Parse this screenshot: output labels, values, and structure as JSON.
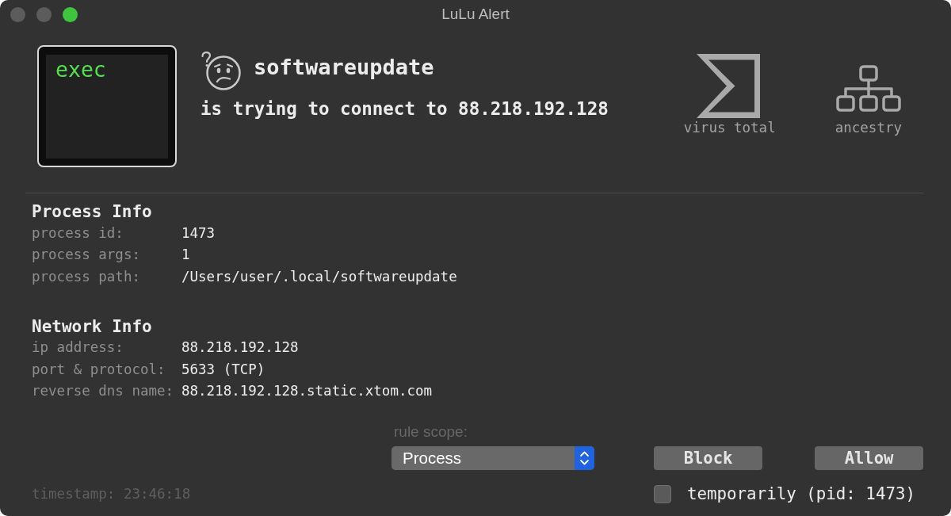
{
  "window": {
    "title": "LuLu Alert",
    "controls": [
      {
        "disabled": true
      },
      {
        "disabled": true
      },
      {
        "disabled": false
      }
    ]
  },
  "process": {
    "icon_text": "exec",
    "name": "softwareupdate",
    "message": "is trying to connect to 88.218.192.128"
  },
  "actions": [
    {
      "kind": "virustotal",
      "label": "virus total"
    },
    {
      "kind": "ancestry",
      "label": "ancestry"
    }
  ],
  "sections": [
    {
      "title": "Process Info",
      "rows": [
        {
          "label": "process id:",
          "value": "1473"
        },
        {
          "label": "process args:",
          "value": "1"
        },
        {
          "label": "process path:",
          "value": "/Users/user/.local/softwareupdate"
        }
      ]
    },
    {
      "title": "Network Info",
      "rows": [
        {
          "label": "ip address:",
          "value": "88.218.192.128"
        },
        {
          "label": "port & protocol:",
          "value": "5633 (TCP)"
        },
        {
          "label": "reverse dns name:",
          "value": "88.218.192.128.static.xtom.com"
        }
      ]
    }
  ],
  "rule_scope": {
    "label": "rule scope:",
    "value": "Process"
  },
  "buttons": [
    {
      "label": "Block"
    },
    {
      "label": "Allow"
    }
  ],
  "temporarily": {
    "label": "temporarily (pid: 1473)",
    "checked": false
  },
  "timestamp": "timestamp: 23:46:18"
}
